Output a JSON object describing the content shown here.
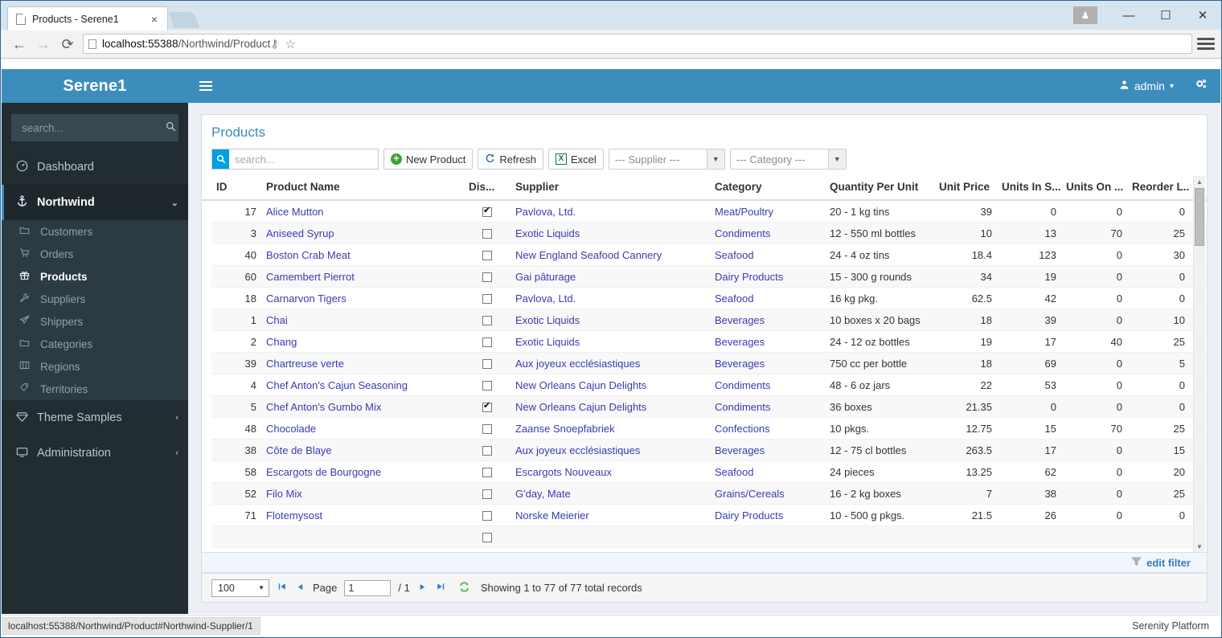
{
  "browser": {
    "tab_title": "Products - Serene1",
    "tab_close": "×",
    "url_host": "localhost:55388",
    "url_path": "/Northwind/Product",
    "back_icon": "←",
    "forward_icon": "→",
    "reload_icon": "⟳",
    "key_icon": "⚷",
    "star_icon": "☆",
    "minimize": "—",
    "maximize": "☐",
    "close": "✕",
    "profile_icon": "♟"
  },
  "sidebar": {
    "brand": "Serene1",
    "search_placeholder": "search...",
    "search_value": "",
    "search_icon": "🔍",
    "items": [
      {
        "label": "Dashboard",
        "icon": "☉",
        "active": false
      },
      {
        "label": "Northwind",
        "icon": "⚓",
        "active": true,
        "caret": "⌄"
      },
      {
        "label": "Theme Samples",
        "icon": "⬠",
        "active": false,
        "caret": "‹"
      },
      {
        "label": "Administration",
        "icon": "⬜",
        "active": false,
        "caret": "‹"
      }
    ],
    "subitems": [
      {
        "label": "Customers",
        "icon": "☐",
        "selected": false
      },
      {
        "label": "Orders",
        "icon": "⛟",
        "selected": false
      },
      {
        "label": "Products",
        "icon": "☘",
        "selected": true
      },
      {
        "label": "Suppliers",
        "icon": "⚒",
        "selected": false
      },
      {
        "label": "Shippers",
        "icon": "✈",
        "selected": false
      },
      {
        "label": "Categories",
        "icon": "☐",
        "selected": false
      },
      {
        "label": "Regions",
        "icon": "◫",
        "selected": false
      },
      {
        "label": "Territories",
        "icon": "⌖",
        "selected": false
      }
    ]
  },
  "topbar": {
    "hamburger_icon": "menu-icon",
    "user_label": "admin",
    "user_icon": "♟",
    "caret": "▾",
    "gear_icon": "⚙"
  },
  "panel": {
    "title": "Products",
    "toolbar": {
      "quick_search_placeholder": "search...",
      "quick_search_value": "",
      "search_icon": "🔍",
      "new_product_label": "New Product",
      "refresh_label": "Refresh",
      "excel_label": "Excel",
      "excel_glyph": "X",
      "plus_glyph": "+",
      "refresh_glyph": "↻",
      "supplier_filter": "--- Supplier ---",
      "category_filter": "--- Category ---",
      "dropdown_arrow": "▼"
    }
  },
  "grid": {
    "columns": [
      "ID",
      "Product Name",
      "Dis...",
      "Supplier",
      "Category",
      "Quantity Per Unit",
      "Unit Price",
      "Units In S...",
      "Units On ...",
      "Reorder L..."
    ],
    "rows": [
      {
        "id": "17",
        "name": "Alice Mutton",
        "discontinued": true,
        "supplier": "Pavlova, Ltd.",
        "category": "Meat/Poultry",
        "qpu": "20 - 1 kg tins",
        "price": "39",
        "in_stock": "0",
        "on_order": "0",
        "reorder": "0"
      },
      {
        "id": "3",
        "name": "Aniseed Syrup",
        "discontinued": false,
        "supplier": "Exotic Liquids",
        "category": "Condiments",
        "qpu": "12 - 550 ml bottles",
        "price": "10",
        "in_stock": "13",
        "on_order": "70",
        "reorder": "25"
      },
      {
        "id": "40",
        "name": "Boston Crab Meat",
        "discontinued": false,
        "supplier": "New England Seafood Cannery",
        "category": "Seafood",
        "qpu": "24 - 4 oz tins",
        "price": "18.4",
        "in_stock": "123",
        "on_order": "0",
        "reorder": "30"
      },
      {
        "id": "60",
        "name": "Camembert Pierrot",
        "discontinued": false,
        "supplier": "Gai pâturage",
        "category": "Dairy Products",
        "qpu": "15 - 300 g rounds",
        "price": "34",
        "in_stock": "19",
        "on_order": "0",
        "reorder": "0"
      },
      {
        "id": "18",
        "name": "Carnarvon Tigers",
        "discontinued": false,
        "supplier": "Pavlova, Ltd.",
        "category": "Seafood",
        "qpu": "16 kg pkg.",
        "price": "62.5",
        "in_stock": "42",
        "on_order": "0",
        "reorder": "0"
      },
      {
        "id": "1",
        "name": "Chai",
        "discontinued": false,
        "supplier": "Exotic Liquids",
        "category": "Beverages",
        "qpu": "10 boxes x 20 bags",
        "price": "18",
        "in_stock": "39",
        "on_order": "0",
        "reorder": "10"
      },
      {
        "id": "2",
        "name": "Chang",
        "discontinued": false,
        "supplier": "Exotic Liquids",
        "category": "Beverages",
        "qpu": "24 - 12 oz bottles",
        "price": "19",
        "in_stock": "17",
        "on_order": "40",
        "reorder": "25"
      },
      {
        "id": "39",
        "name": "Chartreuse verte",
        "discontinued": false,
        "supplier": "Aux joyeux ecclésiastiques",
        "category": "Beverages",
        "qpu": "750 cc per bottle",
        "price": "18",
        "in_stock": "69",
        "on_order": "0",
        "reorder": "5"
      },
      {
        "id": "4",
        "name": "Chef Anton's Cajun Seasoning",
        "discontinued": false,
        "supplier": "New Orleans Cajun Delights",
        "category": "Condiments",
        "qpu": "48 - 6 oz jars",
        "price": "22",
        "in_stock": "53",
        "on_order": "0",
        "reorder": "0"
      },
      {
        "id": "5",
        "name": "Chef Anton's Gumbo Mix",
        "discontinued": true,
        "supplier": "New Orleans Cajun Delights",
        "category": "Condiments",
        "qpu": "36 boxes",
        "price": "21.35",
        "in_stock": "0",
        "on_order": "0",
        "reorder": "0"
      },
      {
        "id": "48",
        "name": "Chocolade",
        "discontinued": false,
        "supplier": "Zaanse Snoepfabriek",
        "category": "Confections",
        "qpu": "10 pkgs.",
        "price": "12.75",
        "in_stock": "15",
        "on_order": "70",
        "reorder": "25"
      },
      {
        "id": "38",
        "name": "Côte de Blaye",
        "discontinued": false,
        "supplier": "Aux joyeux ecclésiastiques",
        "category": "Beverages",
        "qpu": "12 - 75 cl bottles",
        "price": "263.5",
        "in_stock": "17",
        "on_order": "0",
        "reorder": "15"
      },
      {
        "id": "58",
        "name": "Escargots de Bourgogne",
        "discontinued": false,
        "supplier": "Escargots Nouveaux",
        "category": "Seafood",
        "qpu": "24 pieces",
        "price": "13.25",
        "in_stock": "62",
        "on_order": "0",
        "reorder": "20"
      },
      {
        "id": "52",
        "name": "Filo Mix",
        "discontinued": false,
        "supplier": "G'day, Mate",
        "category": "Grains/Cereals",
        "qpu": "16 - 2 kg boxes",
        "price": "7",
        "in_stock": "38",
        "on_order": "0",
        "reorder": "25"
      },
      {
        "id": "71",
        "name": "Flotemysost",
        "discontinued": false,
        "supplier": "Norske Meierier",
        "category": "Dairy Products",
        "qpu": "10 - 500 g pkgs.",
        "price": "21.5",
        "in_stock": "26",
        "on_order": "0",
        "reorder": "0"
      }
    ],
    "scroll_up_icon": "▲",
    "scroll_down_icon": "▼"
  },
  "filter_bar": {
    "label": "edit filter",
    "funnel_icon": "▽"
  },
  "pager": {
    "page_size": "100",
    "first_icon": "⏮",
    "prev_icon": "◀",
    "page_label": "Page",
    "page_value": "1",
    "of_label": "/ 1",
    "next_icon": "▶",
    "last_icon": "⏭",
    "refresh_icon": "♻",
    "info": "Showing 1 to 77 of 77 total records",
    "dropdown_arrow": "▼"
  },
  "statusbar": {
    "link": "localhost:55388/Northwind/Product#Northwind-Supplier/1",
    "right": "Serenity Platform"
  },
  "colors": {
    "brand_blue": "#3c8dbc",
    "sidebar_dark": "#222d32",
    "sidebar_sub": "#2c3b41",
    "link_blue": "#3a3ab0",
    "accent_cyan": "#00a0e3"
  }
}
